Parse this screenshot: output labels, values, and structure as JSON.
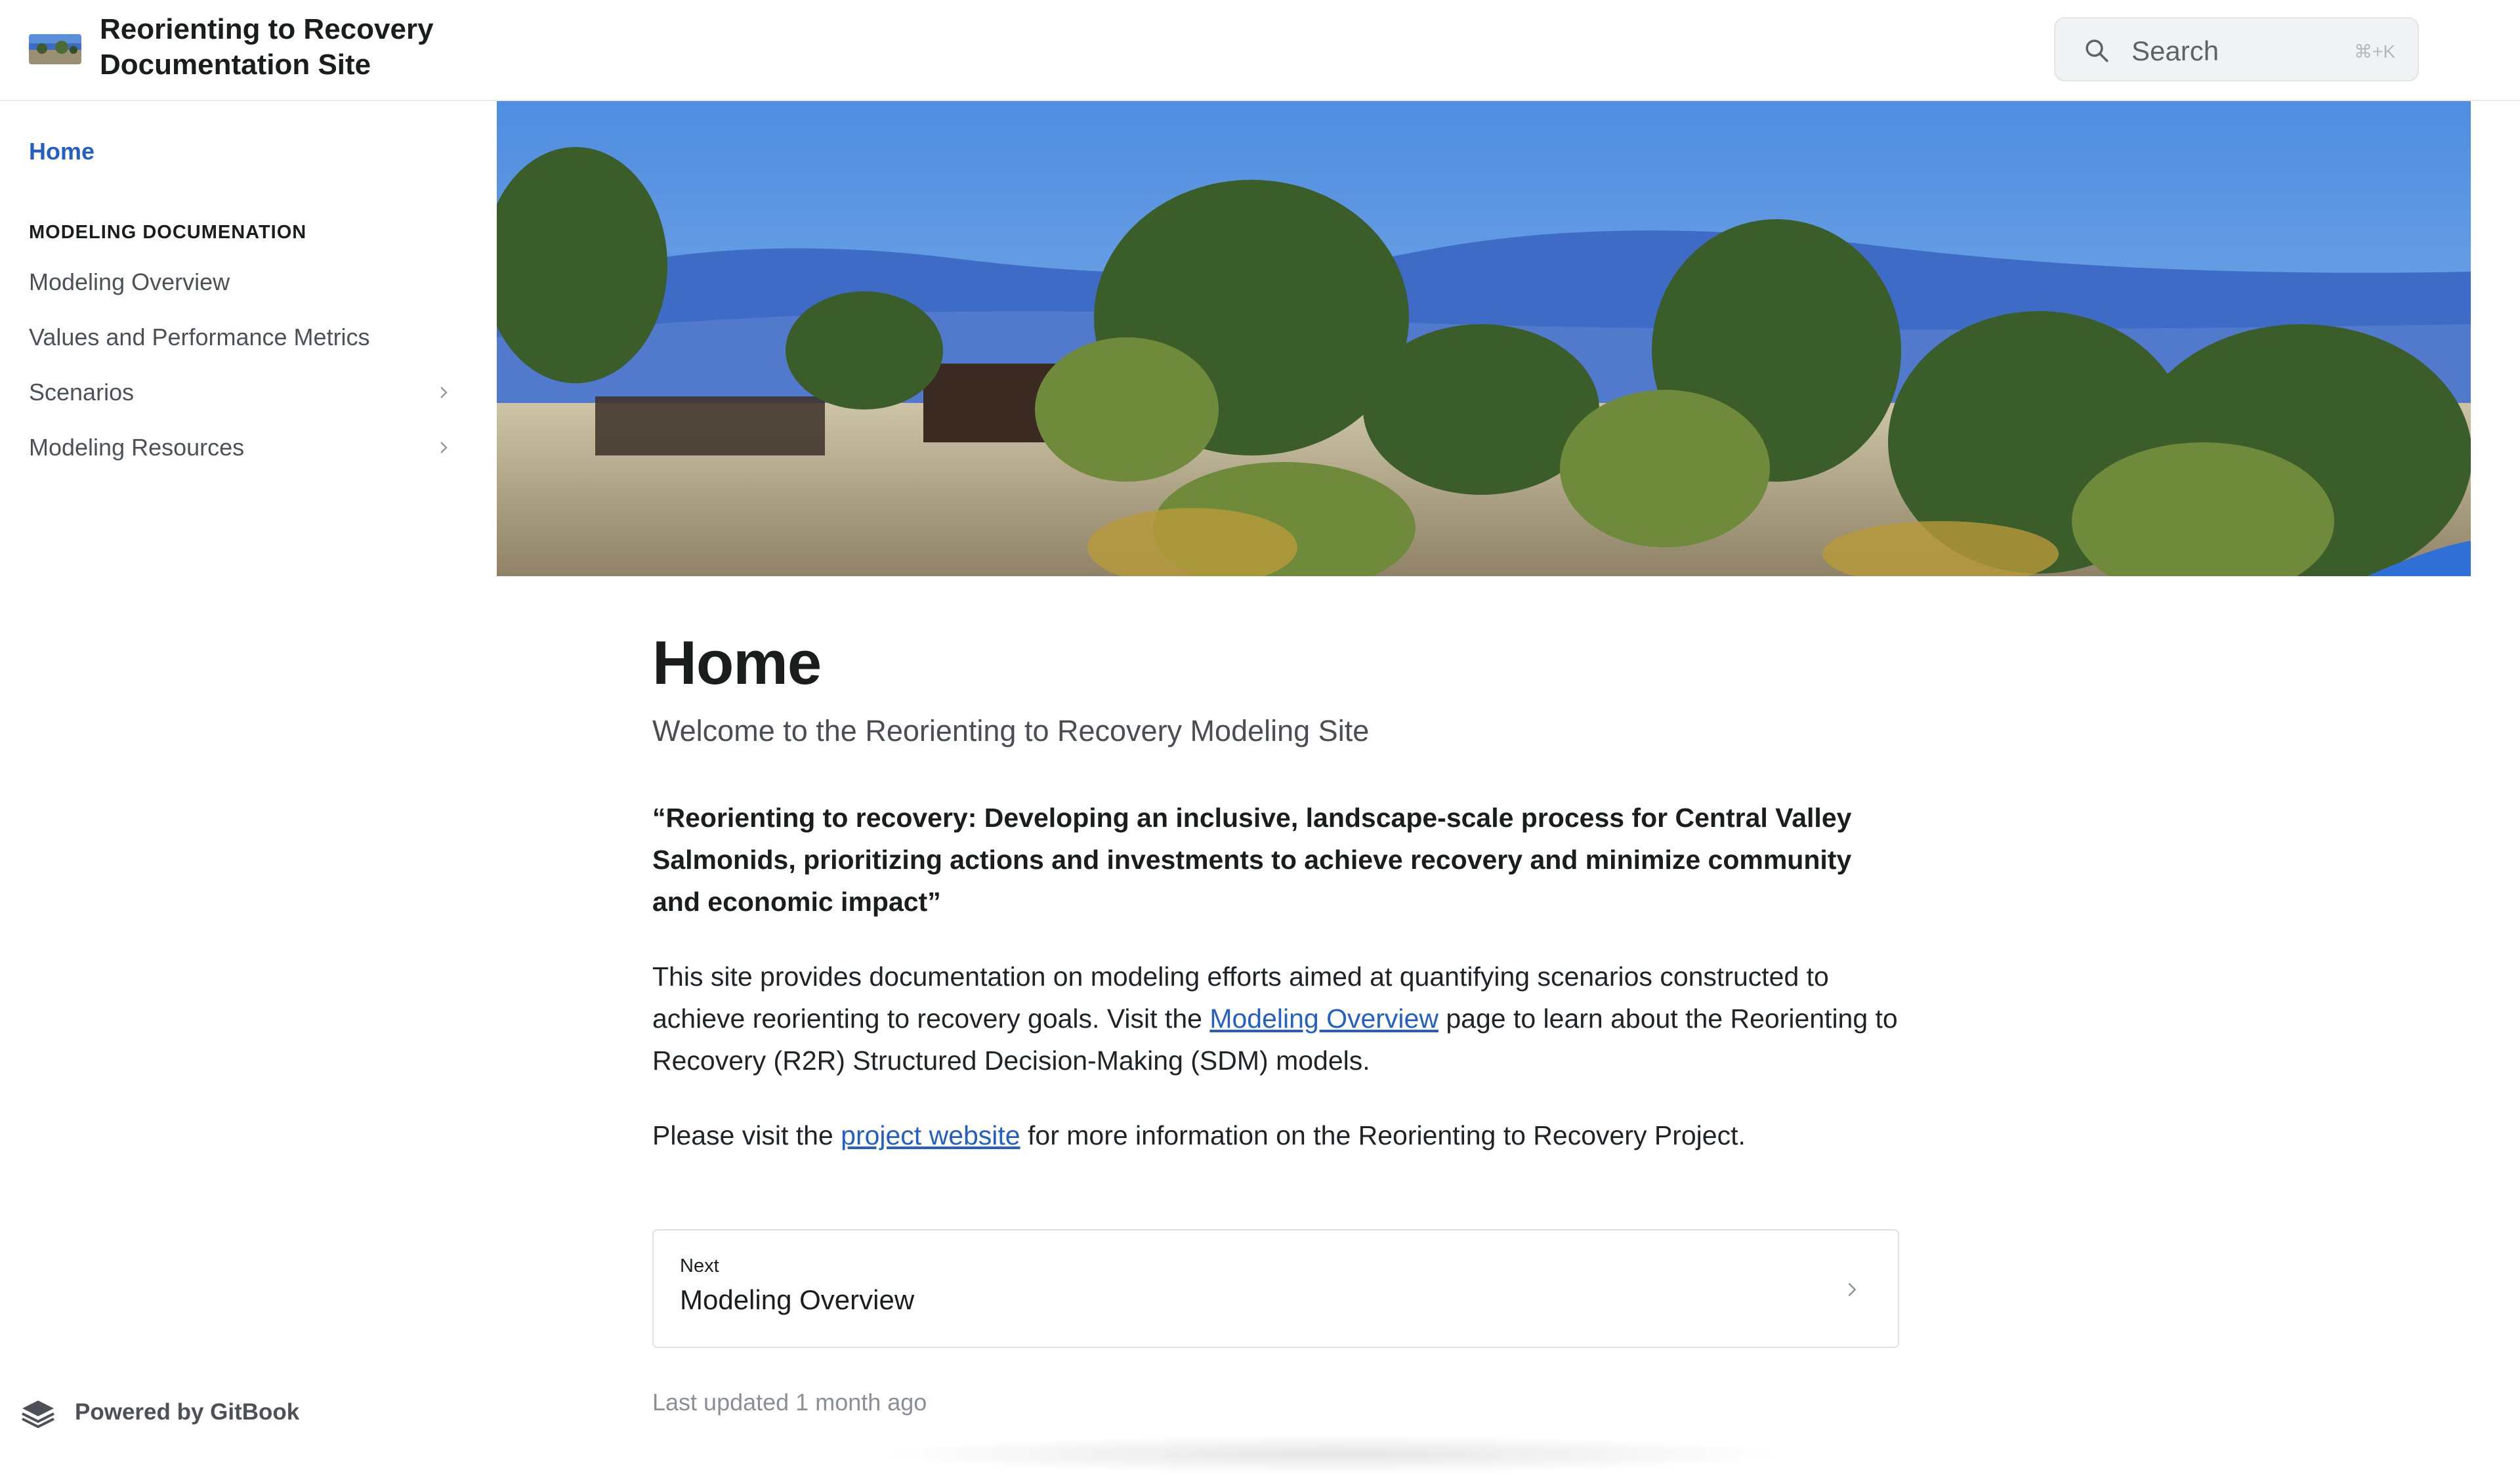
{
  "header": {
    "site_title": "Reorienting to Recovery Documentation Site",
    "search": {
      "placeholder": "Search",
      "shortcut": "⌘+K"
    }
  },
  "sidebar": {
    "home": "Home",
    "section_title": "MODELING DOCUMENATION",
    "items": [
      {
        "label": "Modeling Overview",
        "expandable": false
      },
      {
        "label": "Values and Performance Metrics",
        "expandable": false
      },
      {
        "label": "Scenarios",
        "expandable": true
      },
      {
        "label": "Modeling Resources",
        "expandable": true
      }
    ],
    "powered_by": "Powered by GitBook"
  },
  "page": {
    "title": "Home",
    "description": "Welcome to the Reorienting to Recovery Modeling Site",
    "quote": "“Reorienting to recovery: Developing an inclusive, landscape-scale process for Central Valley Salmonids, prioritizing actions and investments to achieve recovery and minimize community and economic impact”",
    "para1": {
      "before": "This site provides documentation on modeling efforts aimed at quantifying scenarios constructed to achieve reorienting to recovery goals. Visit the ",
      "link": "Modeling Overview",
      "after": " page to learn about the Reorienting to Recovery (R2R) Structured Decision-Making (SDM) models."
    },
    "para2": {
      "before": "Please visit the ",
      "link": "project website",
      "after": " for more information on the Reorienting to Recovery Project."
    },
    "next": {
      "kicker": "Next",
      "title": "Modeling Overview"
    },
    "last_updated": "Last updated 1 month ago"
  },
  "colors": {
    "accent": "#2460c4",
    "text": "#1b1c1e",
    "muted": "#4d5157"
  }
}
